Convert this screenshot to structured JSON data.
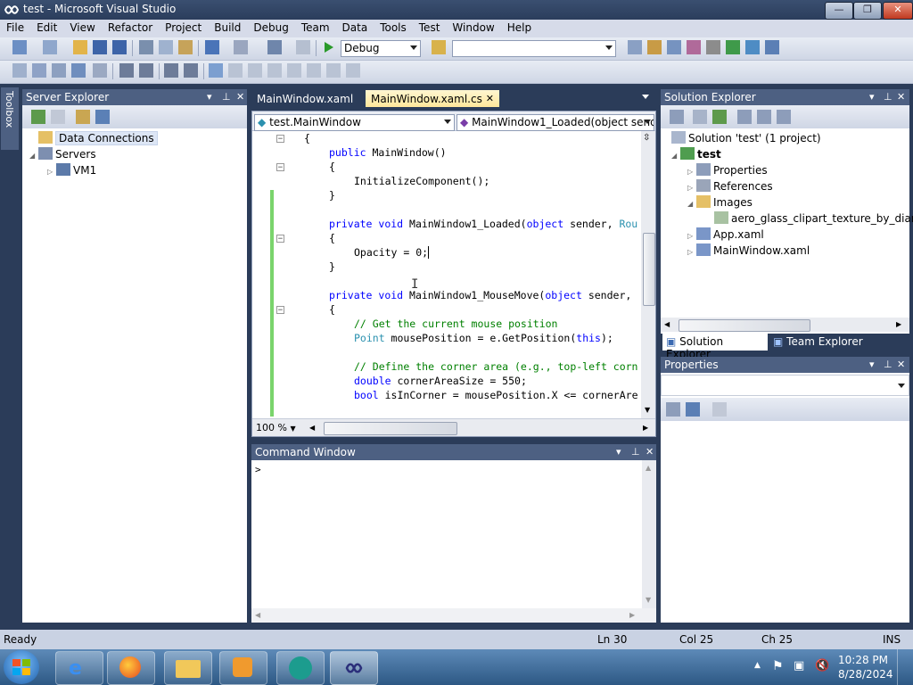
{
  "window": {
    "title": "test - Microsoft Visual Studio",
    "min": "—",
    "max": "❐",
    "close": "✕"
  },
  "menu": [
    "File",
    "Edit",
    "View",
    "Refactor",
    "Project",
    "Build",
    "Debug",
    "Team",
    "Data",
    "Tools",
    "Test",
    "Window",
    "Help"
  ],
  "toolbar": {
    "config": "Debug",
    "find": ""
  },
  "toolbox": {
    "label": "Toolbox"
  },
  "server_explorer": {
    "title": "Server Explorer",
    "items": [
      {
        "label": "Data Connections"
      },
      {
        "label": "Servers"
      },
      {
        "label": "VM1"
      }
    ]
  },
  "editor": {
    "tabs": [
      {
        "label": "MainWindow.xaml"
      },
      {
        "label": "MainWindow.xaml.cs"
      }
    ],
    "class_combo": "test.MainWindow",
    "member_combo": "MainWindow1_Loaded(object send",
    "zoom": "100 %",
    "lines": [
      {
        "text": "{",
        "indent": 0
      },
      {
        "text": "public MainWindow()",
        "indent": 1
      },
      {
        "text": "{",
        "indent": 1
      },
      {
        "text": "InitializeComponent();",
        "indent": 2
      },
      {
        "text": "}",
        "indent": 1
      },
      {
        "text": "private void MainWindow1_Loaded(object sender, Rou",
        "indent": 1
      },
      {
        "text": "{",
        "indent": 1
      },
      {
        "text": "Opacity = 0;",
        "indent": 2
      },
      {
        "text": "}",
        "indent": 1
      },
      {
        "text": "private void MainWindow1_MouseMove(object sender,",
        "indent": 1
      },
      {
        "text": "{",
        "indent": 1
      },
      {
        "text": "// Get the current mouse position",
        "indent": 2
      },
      {
        "text": "Point mousePosition = e.GetPosition(this);",
        "indent": 2
      },
      {
        "text": "// Define the corner area (e.g., top-left corn",
        "indent": 2
      },
      {
        "text": "double cornerAreaSize = 550;",
        "indent": 2
      },
      {
        "text": "bool isInCorner = mousePosition.X <= cornerAre",
        "indent": 2
      }
    ]
  },
  "command_window": {
    "title": "Command Window",
    "prompt": ">"
  },
  "solution_explorer": {
    "title": "Solution Explorer",
    "items": [
      {
        "label": "Solution 'test' (1 project)"
      },
      {
        "label": "test"
      },
      {
        "label": "Properties"
      },
      {
        "label": "References"
      },
      {
        "label": "Images"
      },
      {
        "label": "aero_glass_clipart_texture_by_diamo"
      },
      {
        "label": "App.xaml"
      },
      {
        "label": "MainWindow.xaml"
      }
    ],
    "tabs": [
      {
        "label": "Solution Explorer"
      },
      {
        "label": "Team Explorer"
      }
    ]
  },
  "properties": {
    "title": "Properties"
  },
  "status": {
    "text": "Ready",
    "ln": "Ln 30",
    "col": "Col 25",
    "ch": "Ch 25",
    "ins": "INS"
  },
  "taskbar": {
    "time": "10:28 PM",
    "date": "8/28/2024"
  }
}
